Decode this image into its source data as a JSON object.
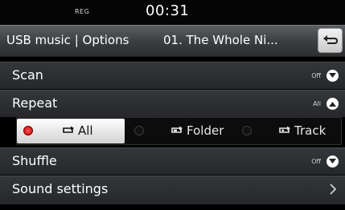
{
  "status": {
    "indicator": "REG",
    "clock": "00:31"
  },
  "header": {
    "title": "USB music",
    "separator": "|",
    "subtitle": "Options",
    "track": "01. The Whole Ni...",
    "back_icon": "back-arrow-icon"
  },
  "menu": {
    "scan": {
      "label": "Scan",
      "value": "Off",
      "icon": "chevron-down-icon"
    },
    "repeat": {
      "label": "Repeat",
      "value": "All",
      "icon": "chevron-up-icon"
    },
    "repeat_options": [
      {
        "label": "All",
        "icon": "repeat-all-icon",
        "selected": true
      },
      {
        "label": "Folder",
        "icon": "repeat-folder-icon",
        "selected": false
      },
      {
        "label": "Track",
        "icon": "repeat-track-icon",
        "selected": false
      }
    ],
    "shuffle": {
      "label": "Shuffle",
      "value": "Off",
      "icon": "chevron-down-icon"
    },
    "sound": {
      "label": "Sound settings",
      "icon": "chevron-right-icon"
    }
  },
  "colors": {
    "selected_radio": "#d40000",
    "row_bg": "#2b2d30",
    "title_bg": "#45484b"
  }
}
